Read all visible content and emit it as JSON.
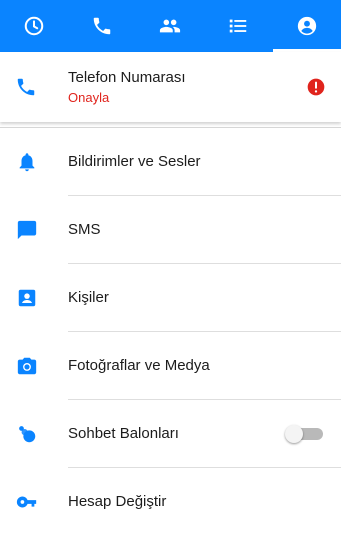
{
  "colors": {
    "accent": "#0a84ff",
    "error": "#e0241d"
  },
  "tabs": [
    {
      "icon": "clock-icon",
      "selected": false
    },
    {
      "icon": "phone-icon",
      "selected": false
    },
    {
      "icon": "people-icon",
      "selected": false
    },
    {
      "icon": "list-icon",
      "selected": false
    },
    {
      "icon": "account-circle-icon",
      "selected": true
    }
  ],
  "phone": {
    "title": "Telefon Numarası",
    "action": "Onayla",
    "icon": "phone-icon",
    "status_icon": "alert-icon"
  },
  "settings": [
    {
      "label": "Bildirimler ve Sesler",
      "icon": "bell-icon"
    },
    {
      "label": "SMS",
      "icon": "message-icon"
    },
    {
      "label": "Kişiler",
      "icon": "contact-card-icon"
    },
    {
      "label": "Fotoğraflar ve Medya",
      "icon": "camera-icon"
    },
    {
      "label": "Sohbet Balonları",
      "icon": "chat-bubbles-icon",
      "toggle": false
    },
    {
      "label": "Hesap Değiştir",
      "icon": "key-icon"
    }
  ]
}
